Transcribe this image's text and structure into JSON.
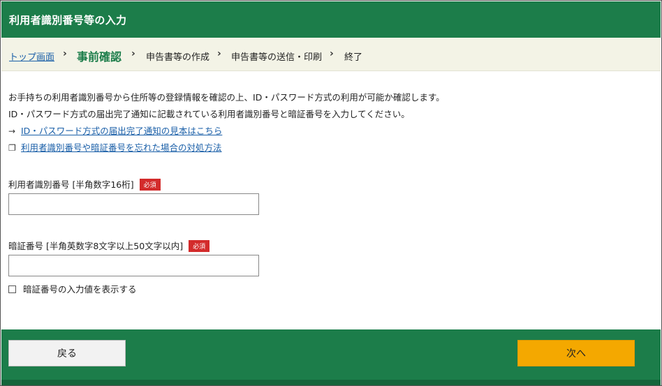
{
  "header": {
    "title": "利用者識別番号等の入力"
  },
  "breadcrumb": {
    "items": [
      {
        "label": "トップ画面",
        "type": "link"
      },
      {
        "label": "事前確認",
        "type": "current"
      },
      {
        "label": "申告書等の作成",
        "type": "step"
      },
      {
        "label": "申告書等の送信・印刷",
        "type": "step"
      },
      {
        "label": "終了",
        "type": "step"
      }
    ],
    "separator": "›"
  },
  "main": {
    "description_line1": "お手持ちの利用者識別番号から住所等の登録情報を確認の上、ID・パスワード方式の利用が可能か確認します。",
    "description_line2": "ID・パスワード方式の届出完了通知に記載されている利用者識別番号と暗証番号を入力してください。",
    "link1": {
      "icon": "arrow-right-icon",
      "glyph": "→",
      "label": "ID・パスワード方式の届出完了通知の見本はこちら"
    },
    "link2": {
      "icon": "new-window-icon",
      "glyph": "❐",
      "label": "利用者識別番号や暗証番号を忘れた場合の対処方法"
    },
    "user_id_field": {
      "label": "利用者識別番号 [半角数字16桁]",
      "badge": "必須",
      "value": ""
    },
    "password_field": {
      "label": "暗証番号 [半角英数字8文字以上50文字以内]",
      "badge": "必須",
      "value": ""
    },
    "show_password": {
      "label": "暗証番号の入力値を表示する",
      "checked": false
    }
  },
  "footer": {
    "back_label": "戻る",
    "next_label": "次へ"
  },
  "colors": {
    "primary_green": "#1c7d4a",
    "accent_orange": "#f4a800",
    "required_red": "#d32b2b",
    "link_blue": "#1a5fa8"
  }
}
